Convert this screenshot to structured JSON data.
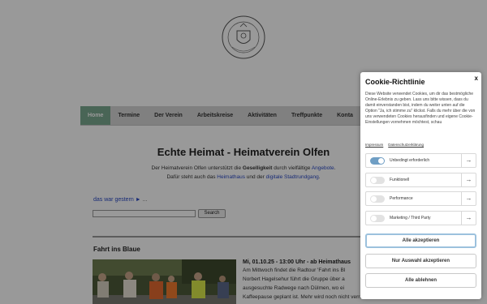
{
  "nav": {
    "items": [
      {
        "label": "Home",
        "active": true
      },
      {
        "label": "Termine"
      },
      {
        "label": "Der Verein"
      },
      {
        "label": "Arbeitskreise"
      },
      {
        "label": "Aktivitäten"
      },
      {
        "label": "Treffpunkte"
      },
      {
        "label": "Konta"
      }
    ]
  },
  "main": {
    "headline": "Echte Heimat - Heimatverein Olfen",
    "intro_line1_a": "Der Heimatverein Olfen unterstützt die ",
    "intro_line1_b": "Geselligkeit",
    "intro_line1_c": " durch vielfältige ",
    "intro_line1_link": "Angebote",
    "intro_line1_end": ".",
    "intro_line2_a": "Dafür steht auch das ",
    "intro_line2_link1": "Heimathaus",
    "intro_line2_b": " und der ",
    "intro_line2_link2": "digitale Stadtrundgang",
    "intro_line2_end": ".",
    "prev_link": "das war gestern ►",
    "prev_ellipsis": " ...",
    "search_value": "",
    "search_button": "Search",
    "section_title": "Fahrt ins Blaue",
    "event_title": "Mi, 01.10.25 - 13:00 Uhr - ab Heimathaus",
    "event_lines": [
      "Am Mittwoch findet die Radtour 'Fahrt ins Bl",
      "Norbert Hagelsehur führt die Gruppe über a",
      "ausgesuchte Radwege nach Dülmen, wo ei",
      "Kaffeepause geplant ist. Mehr wird noch nicht verraten."
    ]
  },
  "cookie": {
    "close": "x",
    "title": "Cookie-Richtlinie",
    "text": "Diese Website verwendet Cookies, um dir das bestmögliche Online-Erlebnis zu geben. Lass uns bitte wissen, dass du damit einverstanden bist, indem du weiter unten auf die Option \"Ja, ich stimme zu\" klickst. Falls du mehr über die von uns verwendeten Cookies herausfinden und eigene Cookie-Einstellungen vornehmen möchtest, schau",
    "link_impressum": "Impressum",
    "link_privacy": "Datenschutzerklärung",
    "rows": [
      {
        "label": "Unbedingt erforderlich",
        "on": true
      },
      {
        "label": "Funktionell",
        "on": false
      },
      {
        "label": "Performance",
        "on": false
      },
      {
        "label": "Marketing / Third Party",
        "on": false
      }
    ],
    "accept_all": "Alle akzeptieren",
    "accept_selected": "Nur Auswahl akzeptieren",
    "reject_all": "Alle ablehnen"
  },
  "colors": {
    "nav_active": "#7aa890",
    "link": "#2a49c5",
    "toggle_on": "#6f9ec4"
  },
  "icons": {
    "row_arrow": "arrow-right-icon",
    "seal": "city-seal-icon"
  }
}
